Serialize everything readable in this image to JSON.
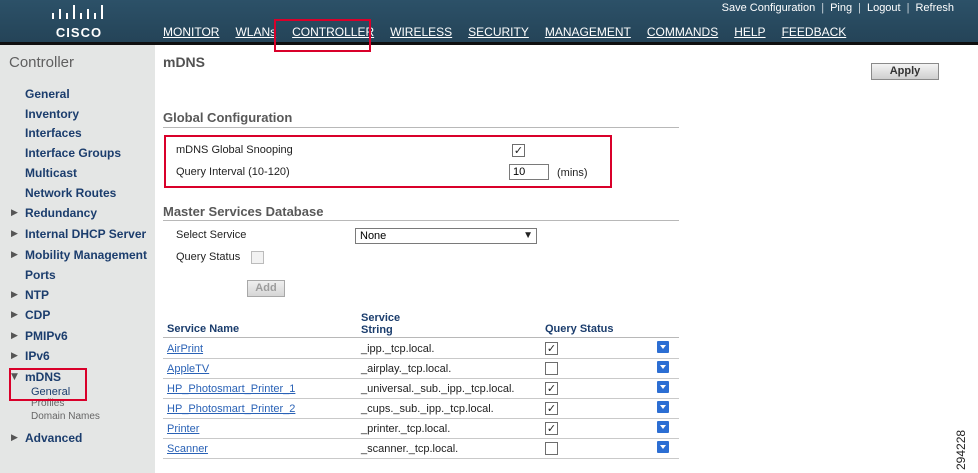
{
  "brand": {
    "logo_text": "CISCO"
  },
  "top_links": [
    "Save Configuration",
    "Ping",
    "Logout",
    "Refresh"
  ],
  "nav": [
    "MONITOR",
    "WLANs",
    "CONTROLLER",
    "WIRELESS",
    "SECURITY",
    "MANAGEMENT",
    "COMMANDS",
    "HELP",
    "FEEDBACK"
  ],
  "nav_active": "CONTROLLER",
  "sidebar": {
    "title": "Controller",
    "items": [
      {
        "label": "General",
        "expandable": false
      },
      {
        "label": "Inventory",
        "expandable": false
      },
      {
        "label": "Interfaces",
        "expandable": false
      },
      {
        "label": "Interface Groups",
        "expandable": false
      },
      {
        "label": "Multicast",
        "expandable": false
      },
      {
        "label": "Network Routes",
        "expandable": false
      },
      {
        "label": "Redundancy",
        "expandable": true
      },
      {
        "label": "Internal DHCP Server",
        "expandable": true
      },
      {
        "label": "Mobility Management",
        "expandable": true
      },
      {
        "label": "Ports",
        "expandable": false
      },
      {
        "label": "NTP",
        "expandable": true
      },
      {
        "label": "CDP",
        "expandable": true
      },
      {
        "label": "PMIPv6",
        "expandable": true
      },
      {
        "label": "IPv6",
        "expandable": true
      },
      {
        "label": "mDNS",
        "expandable": true,
        "expanded": true
      },
      {
        "label": "Advanced",
        "expandable": true
      }
    ],
    "mdns_subitems": [
      "General",
      "Profiles",
      "Domain Names"
    ]
  },
  "page": {
    "title": "mDNS",
    "apply_label": "Apply",
    "global_config": {
      "heading": "Global Configuration",
      "snooping_label": "mDNS Global Snooping",
      "snooping_checked": true,
      "query_interval_label": "Query Interval (10-120)",
      "query_interval_value": "10",
      "query_interval_unit": "(mins)"
    },
    "master_db": {
      "heading": "Master Services Database",
      "select_service_label": "Select Service",
      "select_service_value": "None",
      "query_status_label": "Query Status",
      "query_status_checked": false,
      "add_label": "Add"
    },
    "table": {
      "columns": [
        "Service Name",
        "Service String",
        "Query Status"
      ],
      "rows": [
        {
          "name": "AirPrint",
          "string": "_ipp._tcp.local.",
          "query": true
        },
        {
          "name": "AppleTV",
          "string": "_airplay._tcp.local.",
          "query": false
        },
        {
          "name": "HP_Photosmart_Printer_1",
          "string": "_universal._sub._ipp._tcp.local.",
          "query": true
        },
        {
          "name": "HP_Photosmart_Printer_2",
          "string": "_cups._sub._ipp._tcp.local.",
          "query": true
        },
        {
          "name": "Printer",
          "string": "_printer._tcp.local.",
          "query": true
        },
        {
          "name": "Scanner",
          "string": "_scanner._tcp.local.",
          "query": false
        }
      ]
    }
  },
  "figure_id": "294228",
  "colors": {
    "header": "#2c5168",
    "highlight": "#d9002a",
    "sidebar": "#e4e6e5",
    "link": "#1b3d6d"
  }
}
